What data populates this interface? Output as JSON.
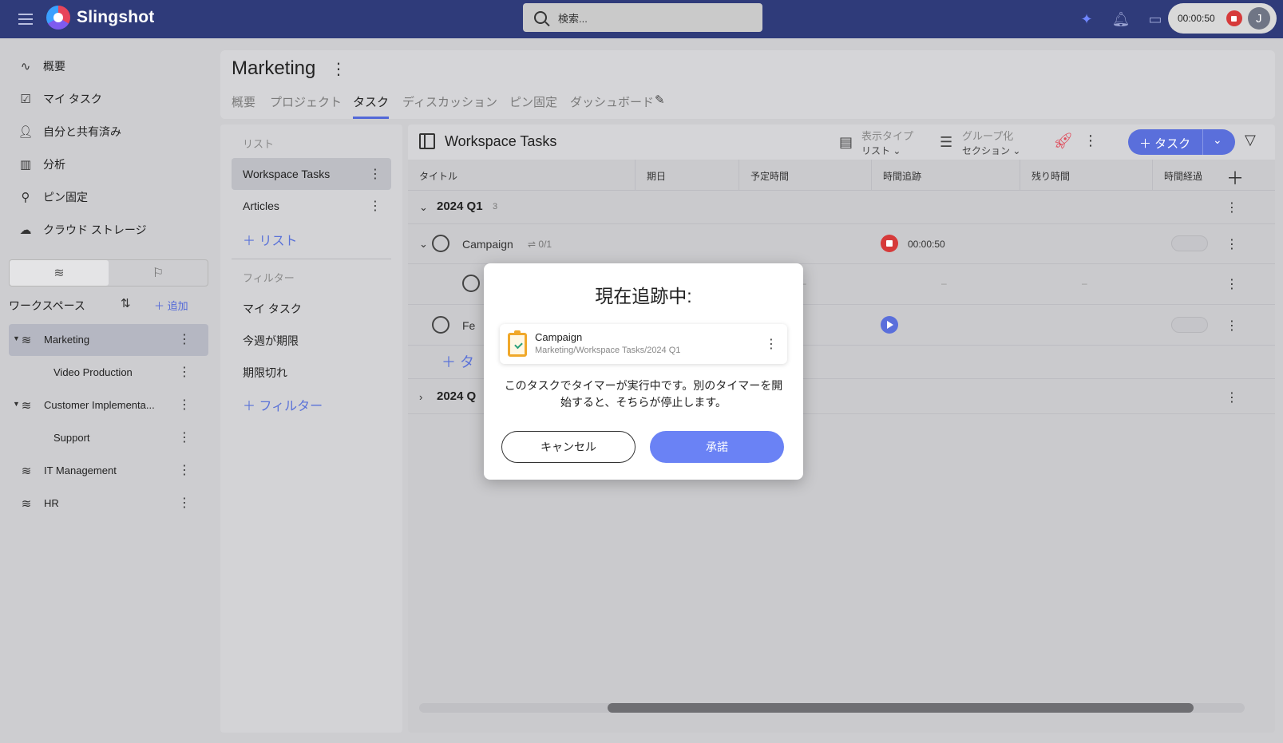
{
  "app": {
    "name": "Slingshot"
  },
  "search": {
    "placeholder": "検索..."
  },
  "topbar": {
    "timer": "00:00:50",
    "avatar_initial": "J"
  },
  "nav": [
    {
      "icon": "activity-icon",
      "label": "概要"
    },
    {
      "icon": "task-icon",
      "label": "マイ タスク"
    },
    {
      "icon": "shared-user-icon",
      "label": "自分と共有済み"
    },
    {
      "icon": "chart-icon",
      "label": "分析"
    },
    {
      "icon": "pin-icon",
      "label": "ピン固定"
    },
    {
      "icon": "cloud-icon",
      "label": "クラウド ストレージ"
    }
  ],
  "workspaces": {
    "title": "ワークスペース",
    "add_label": "追加",
    "items": [
      {
        "label": "Marketing",
        "active": true,
        "expandable": true,
        "indent": false
      },
      {
        "label": "Video Production",
        "active": false,
        "expandable": false,
        "indent": true
      },
      {
        "label": "Customer Implementa...",
        "active": false,
        "expandable": true,
        "indent": false
      },
      {
        "label": "Support",
        "active": false,
        "expandable": false,
        "indent": true
      },
      {
        "label": "IT Management",
        "active": false,
        "expandable": false,
        "indent": false
      },
      {
        "label": "HR",
        "active": false,
        "expandable": false,
        "indent": false
      }
    ]
  },
  "project": {
    "title": "Marketing",
    "tabs": [
      "概要",
      "プロジェクト",
      "タスク",
      "ディスカッション",
      "ピン固定",
      "ダッシュボード"
    ],
    "active_tab": "タスク"
  },
  "lists": {
    "heading": "リスト",
    "items": [
      "Workspace Tasks",
      "Articles"
    ],
    "add_label": "リスト",
    "filter_heading": "フィルター",
    "filters": [
      "マイ タスク",
      "今週が期限",
      "期限切れ"
    ],
    "add_filter_label": "フィルター"
  },
  "main": {
    "title": "Workspace Tasks",
    "view_type": {
      "label": "表示タイプ",
      "value": "リスト"
    },
    "group_by": {
      "label": "グループ化",
      "value": "セクション"
    },
    "add_task_label": "タスク",
    "columns": [
      "タイトル",
      "期日",
      "予定時間",
      "時間追跡",
      "残り時間",
      "時間経過"
    ],
    "groups": [
      {
        "title": "2024 Q1",
        "count": "3"
      },
      {
        "title": "2024 Q",
        "count": ""
      }
    ],
    "tasks": [
      {
        "name": "Campaign",
        "subtasks": "0/1",
        "time": "00:00:50"
      },
      {
        "name": "",
        "subtasks": "",
        "time": ""
      },
      {
        "name": "Fe",
        "subtasks": "",
        "time": ""
      }
    ],
    "add_row_label": "タ",
    "dash": "–"
  },
  "modal": {
    "title": "現在追跡中:",
    "task_name": "Campaign",
    "task_path": "Marketing/Workspace Tasks/2024 Q1",
    "message": "このタスクでタイマーが実行中です。別のタイマーを開始すると、そちらが停止します。",
    "cancel_label": "キャンセル",
    "confirm_label": "承諾"
  },
  "colors": {
    "topbar": "#2f3b7a",
    "accent": "#5a6fdb",
    "stop": "#d63a3a"
  }
}
